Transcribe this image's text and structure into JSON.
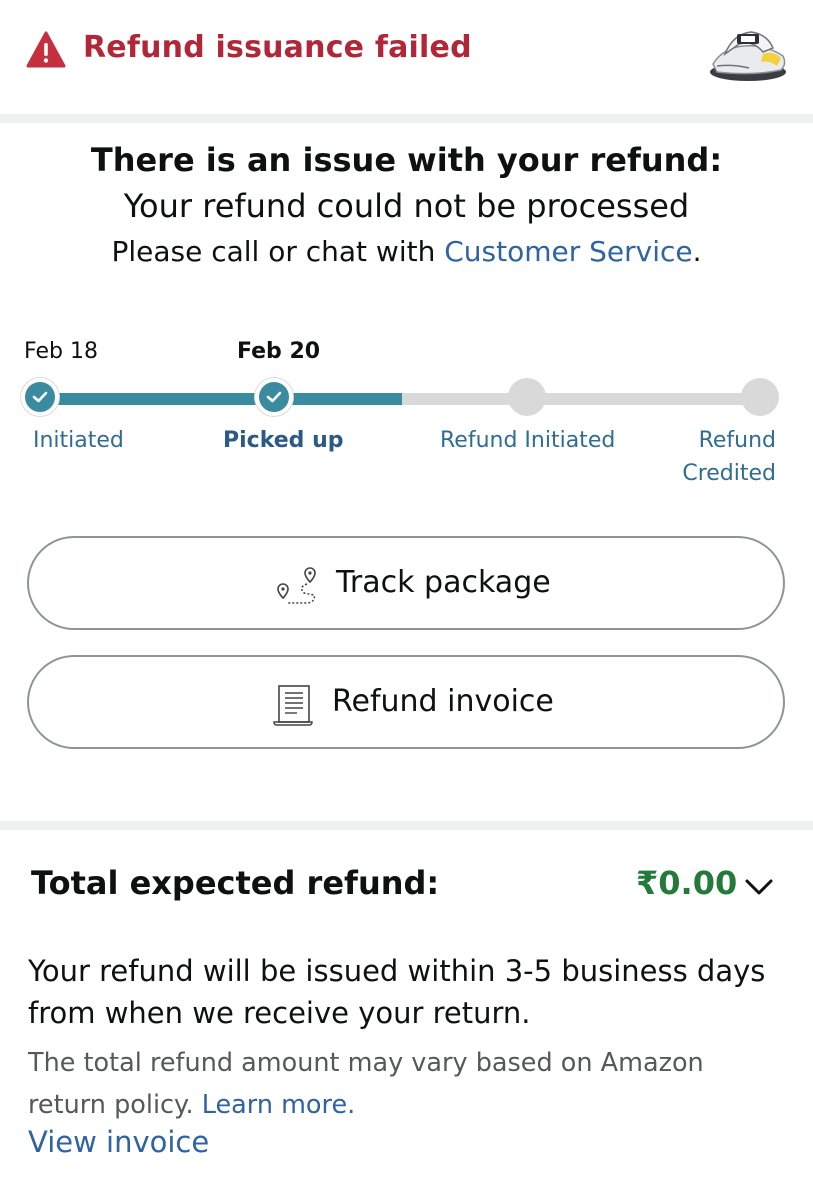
{
  "alert": {
    "title": "Refund issuance failed",
    "color": "#b12737"
  },
  "issue": {
    "heading": "There is an issue with your refund:",
    "subheading": "Your refund could not be processed",
    "help_prefix": "Please call or chat with ",
    "help_link": "Customer Service",
    "help_suffix": "."
  },
  "tracker": {
    "dates": [
      "Feb 18",
      "Feb 20"
    ],
    "progress_completed_steps": 2,
    "steps": [
      {
        "label": "Initiated",
        "status": "done"
      },
      {
        "label": "Picked up",
        "status": "current"
      },
      {
        "label": "Refund Initiated",
        "status": "pending"
      },
      {
        "label_line1": "Refund",
        "label_line2": "Credited",
        "status": "pending"
      }
    ],
    "active_color": "#3b8ba0",
    "inactive_color": "#d9d9d9"
  },
  "buttons": {
    "track": {
      "label": "Track package",
      "icon": "route-pin-icon"
    },
    "invoice": {
      "label": "Refund invoice",
      "icon": "invoice-document-icon"
    }
  },
  "refund": {
    "label": "Total expected refund:",
    "amount": "₹0.00",
    "amount_color": "#237a3b",
    "note": "Your refund will be issued within 3-5 business days from when we receive your return.",
    "policy_text": "The total refund amount may vary based on Amazon return policy. ",
    "policy_link": "Learn more.",
    "view_invoice": "View invoice"
  }
}
